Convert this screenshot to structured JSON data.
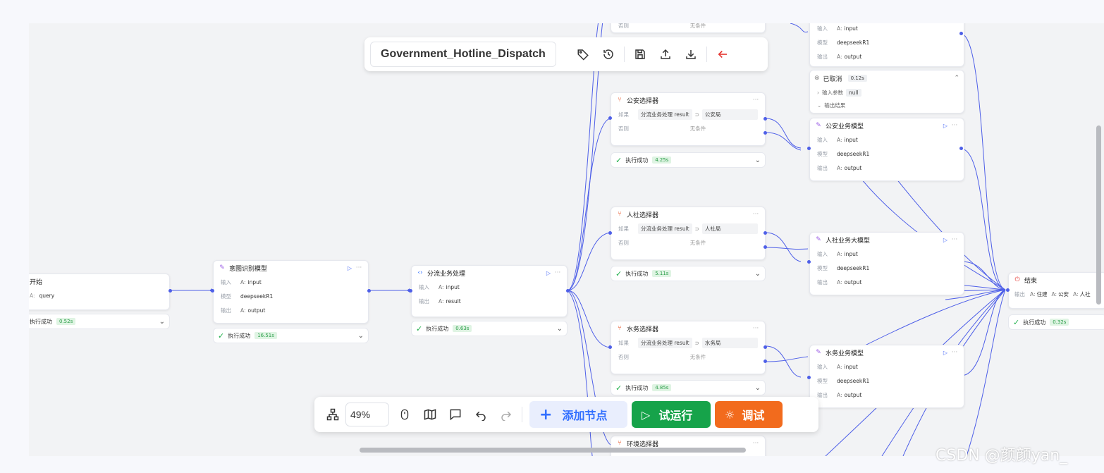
{
  "app": {
    "workflow_name": "Government_Hotline_Dispatch",
    "watermark": "CSDN @颜颜yan_"
  },
  "labels": {
    "input": "输入",
    "model": "模型",
    "output": "输出",
    "if": "如果",
    "else": "否则",
    "success": "执行成功",
    "no_condition": "无条件",
    "input_params": "输入参数",
    "output_result": "输出结果",
    "equals_icon": "⊃"
  },
  "nodes": {
    "start": {
      "title": "开始",
      "input": "query",
      "time": "0.52s"
    },
    "intent": {
      "title": "意图识别模型",
      "input": "input",
      "model": "deepseekR1",
      "output": "output",
      "time": "16.51s"
    },
    "dispatch": {
      "title": "分流业务处理",
      "input": "input",
      "output": "result",
      "time": "0.63s"
    },
    "police_sel": {
      "title": "公安选择器",
      "cond_left": "分流业务处理 result",
      "cond_right": "公安局",
      "time": "4.25s"
    },
    "hr_sel": {
      "title": "人社选择器",
      "cond_left": "分流业务处理 result",
      "cond_right": "人社局",
      "time": "5.11s"
    },
    "water_sel": {
      "title": "水务选择器",
      "cond_left": "分流业务处理 result",
      "cond_right": "水务局",
      "time": "4.85s"
    },
    "env_sel": {
      "title": "环境选择器"
    },
    "top_model": {
      "input": "input",
      "model": "deepseekR1",
      "output": "output"
    },
    "cancelled": {
      "title": "已取消",
      "time": "0.12s",
      "param_value": "null"
    },
    "police_model": {
      "title": "公安业务模型",
      "input": "input",
      "model": "deepseekR1",
      "output": "output"
    },
    "hr_model": {
      "title": "人社业务大模型",
      "input": "input",
      "model": "deepseekR1",
      "output": "output"
    },
    "water_model": {
      "title": "水务业务模型",
      "input": "input",
      "model": "deepseekR1",
      "output": "output"
    },
    "end": {
      "title": "结束",
      "out1": "住建",
      "out2": "公安",
      "out3": "人社",
      "time": "0.32s"
    }
  },
  "toolbar": {
    "zoom": "49%",
    "add_node": "添加节点",
    "test_run": "试运行",
    "debug": "调试"
  },
  "colors": {
    "edge": "#4e5fe8",
    "accent_blue": "#3370ff",
    "run_green": "#16a34a",
    "debug_orange": "#f26b1d",
    "success_green": "#22b14c",
    "back_red": "#e53935"
  },
  "icons": {
    "tag": "tag-icon",
    "history": "history-icon",
    "save": "save-icon",
    "upload": "upload-icon",
    "download": "download-icon",
    "back": "back-arrow-icon"
  }
}
